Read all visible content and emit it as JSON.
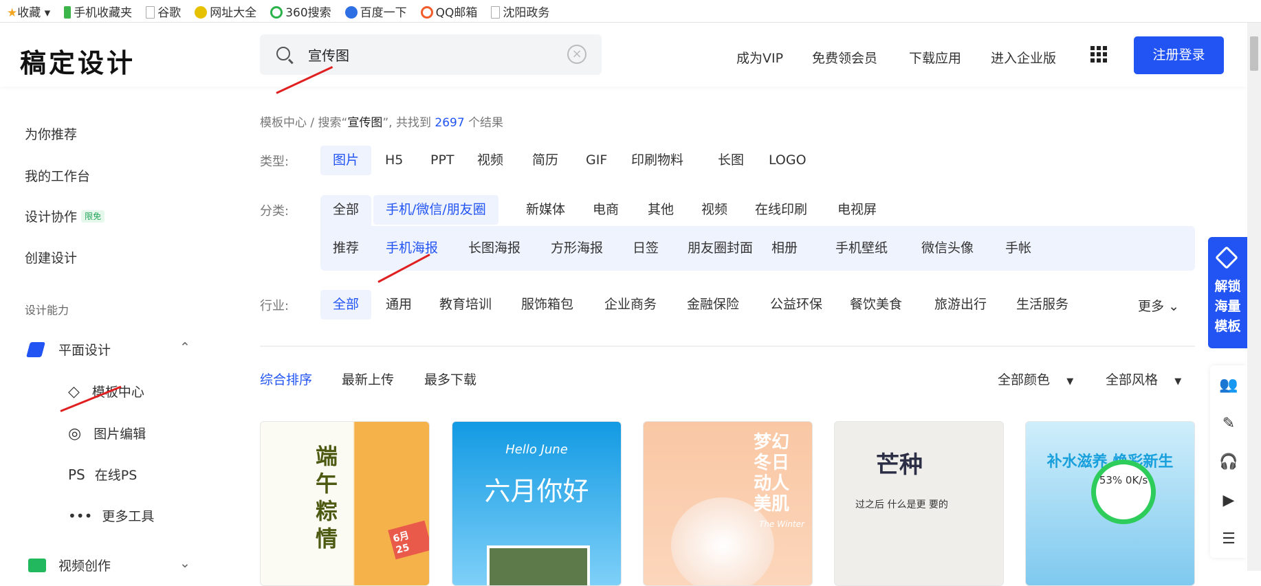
{
  "bookmarks": [
    {
      "label": "收藏",
      "icon": "star-icon",
      "color": "#f4a623"
    },
    {
      "label": "手机收藏夹",
      "icon": "phone-icon",
      "color": "#3bb54a"
    },
    {
      "label": "谷歌",
      "icon": "page-icon",
      "color": "#ccc"
    },
    {
      "label": "网址大全",
      "icon": "site-icon",
      "color": "#e5c100"
    },
    {
      "label": "360搜索",
      "icon": "360-icon",
      "color": "#29b34a"
    },
    {
      "label": "百度一下",
      "icon": "baidu-icon",
      "color": "#2f6fe4"
    },
    {
      "label": "QQ邮箱",
      "icon": "qq-mail-icon",
      "color": "#f25c2a"
    },
    {
      "label": "沈阳政务",
      "icon": "page-icon",
      "color": "#ccc"
    }
  ],
  "header": {
    "logo": "稿定设计",
    "search_value": "宣传图",
    "nav": [
      "成为VIP",
      "免费领会员",
      "下载应用",
      "进入企业版"
    ],
    "login": "注册登录"
  },
  "sidebar": {
    "items": [
      "为你推荐",
      "我的工作台",
      "设计协作",
      "创建设计"
    ],
    "badge": "限免",
    "section": "设计能力",
    "group": "平面设计",
    "sub": [
      {
        "label": "模板中心",
        "icon": "layers-icon"
      },
      {
        "label": "图片编辑",
        "icon": "image-edit-icon"
      },
      {
        "label": "在线PS",
        "icon": "PS"
      },
      {
        "label": "更多工具",
        "icon": "more-icon"
      }
    ],
    "group2": "视频创作"
  },
  "breadcrumb": {
    "root": "模板中心",
    "sep": "/",
    "prefix": "搜索“",
    "query": "宣传图",
    "suffix": "”, 共找到",
    "count": "2697",
    "tail": "个结果"
  },
  "filters": {
    "type_label": "类型:",
    "types": [
      "图片",
      "H5",
      "PPT",
      "视频",
      "简历",
      "GIF",
      "印刷物料",
      "长图",
      "LOGO"
    ],
    "cat_label": "分类:",
    "cats": [
      "全部",
      "手机/微信/朋友圈",
      "新媒体",
      "电商",
      "其他",
      "视频",
      "在线印刷",
      "电视屏"
    ],
    "subcats": [
      "推荐",
      "手机海报",
      "长图海报",
      "方形海报",
      "日签",
      "朋友圈封面",
      "相册",
      "手机壁纸",
      "微信头像",
      "手帐"
    ],
    "ind_label": "行业:",
    "inds": [
      "全部",
      "通用",
      "教育培训",
      "服饰箱包",
      "企业商务",
      "金融保险",
      "公益环保",
      "餐饮美食",
      "旅游出行",
      "生活服务"
    ],
    "more": "更多"
  },
  "sort": {
    "options": [
      "综合排序",
      "最新上传",
      "最多下载"
    ],
    "color": "全部颜色",
    "style": "全部风格"
  },
  "cards": [
    {
      "title": "端午粽情",
      "sub": "6月 25"
    },
    {
      "title": "六月你好",
      "sub": "Hello June"
    },
    {
      "title": "梦幻冬日 动人美肌",
      "sub": "The Winter"
    },
    {
      "title": "芒种",
      "sub": "过之后 什么是更 要的"
    },
    {
      "title": "补水滋养 焕彩新生",
      "sub": "53% 0K/s"
    }
  ],
  "unlock": [
    "解锁",
    "海量",
    "模板"
  ],
  "tools": [
    "users-icon",
    "edit-icon",
    "headset-icon",
    "video-icon",
    "message-icon"
  ],
  "accent": "#2254f4"
}
